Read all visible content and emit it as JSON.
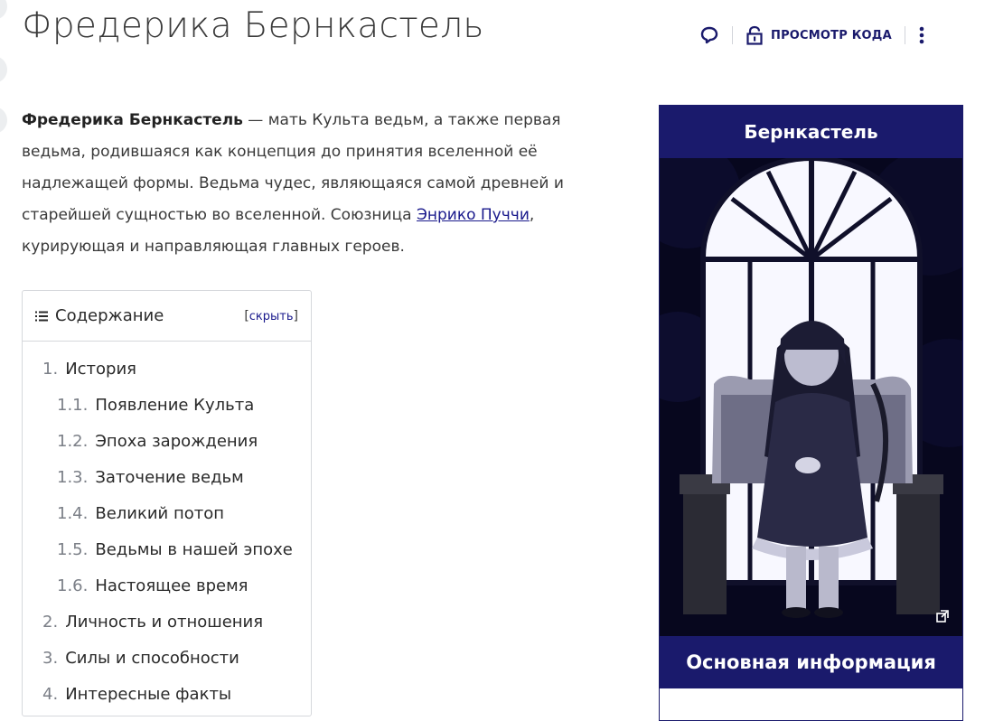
{
  "page": {
    "title": "Фредерика Бернкастель"
  },
  "actions": {
    "view_code_label": "ПРОСМОТР КОДА",
    "comment_icon": "speech-bubble-icon",
    "lock_icon": "lock-icon",
    "more_icon": "kebab-menu-icon"
  },
  "intro": {
    "name_bold": "Фредерика Бернкастель",
    "text_before_link": " — мать Культа ведьм, а также первая ведьма, родившаяся как концепция до принятия вселенной её надлежащей формы. Ведьма чудес, являющаяся самой древней и старейшей сущностью во вселенной. Союзница ",
    "link_text": "Энрико Пуччи",
    "text_after_link": ", курирующая и направляющая главных героев."
  },
  "toc": {
    "title": "Содержание",
    "toggle_open": "[",
    "toggle_label": "скрыть",
    "toggle_close": "]",
    "items": [
      {
        "num": "1.",
        "label": "История",
        "level": 1
      },
      {
        "num": "1.1.",
        "label": "Появление Культа",
        "level": 2
      },
      {
        "num": "1.2.",
        "label": "Эпоха зарождения",
        "level": 2
      },
      {
        "num": "1.3.",
        "label": "Заточение ведьм",
        "level": 2
      },
      {
        "num": "1.4.",
        "label": "Великий потоп",
        "level": 2
      },
      {
        "num": "1.5.",
        "label": "Ведьмы в нашей эпохе",
        "level": 2
      },
      {
        "num": "1.6.",
        "label": "Настоящее время",
        "level": 2
      },
      {
        "num": "2.",
        "label": "Личность и отношения",
        "level": 1
      },
      {
        "num": "3.",
        "label": "Силы и способности",
        "level": 1
      },
      {
        "num": "4.",
        "label": "Интересные факты",
        "level": 1
      }
    ]
  },
  "infobox": {
    "title": "Бернкастель",
    "section_title": "Основная информация",
    "image_expand_icon": "expand-icon"
  },
  "colors": {
    "accent": "#1a1a6c",
    "text": "#3a3a3a",
    "link": "#1a1a8c",
    "border": "#d6d8dc"
  }
}
